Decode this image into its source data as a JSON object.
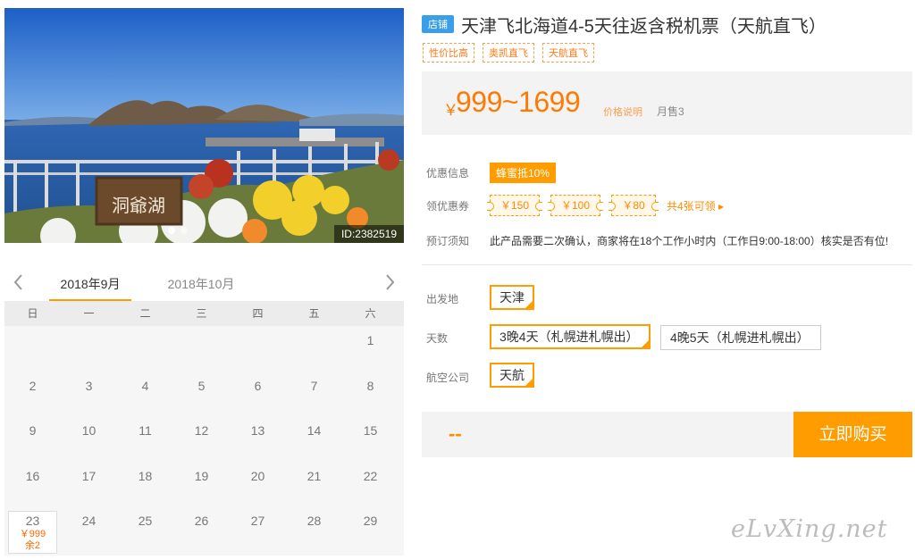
{
  "photo": {
    "id_label": "ID:2382519",
    "sign_text": "洞爺湖"
  },
  "calendar": {
    "tabs": [
      "2018年9月",
      "2018年10月"
    ],
    "weekdays": [
      "日",
      "一",
      "二",
      "三",
      "四",
      "五",
      "六"
    ],
    "days": [
      "",
      "",
      "",
      "",
      "",
      "",
      "1",
      "2",
      "3",
      "4",
      "5",
      "6",
      "7",
      "8",
      "9",
      "10",
      "11",
      "12",
      "13",
      "14",
      "15",
      "16",
      "17",
      "18",
      "19",
      "20",
      "21",
      "22",
      "23",
      "24",
      "25",
      "26",
      "27",
      "28",
      "29"
    ],
    "available_day": {
      "day": "23",
      "price": "￥999",
      "remaining": "余2"
    }
  },
  "product": {
    "shop_badge": "店铺",
    "title": "天津飞北海道4-5天往返含税机票（天航直飞）",
    "tags": [
      "性价比高",
      "奥凯直飞",
      "天航直飞"
    ],
    "price_symbol": "￥",
    "price_range": "999~1699",
    "price_explain": "价格说明",
    "monthly_sales": "月售3"
  },
  "info": {
    "promo_label": "优惠信息",
    "promo_badge": "蜂蜜抵10%",
    "coupon_label": "领优惠券",
    "coupons": [
      "￥150",
      "￥100",
      "￥80"
    ],
    "coupon_more": "共4张可领 ▸",
    "notice_label": "预订须知",
    "notice_text": "此产品需要二次确认，商家将在18个工作小时内（工作日9:00-18:00）核实是否有位!"
  },
  "options": {
    "departure_label": "出发地",
    "departure": "天津",
    "days_label": "天数",
    "days_options": [
      "3晚4天（札幌进札幌出）",
      "4晚5天（札幌进札幌出）"
    ],
    "airline_label": "航空公司",
    "airline": "天航"
  },
  "purchase": {
    "total_placeholder": "--",
    "buy_label": "立即购买"
  },
  "watermark": "eLvXing.net",
  "colors": {
    "accent": "#ff9d00",
    "price": "#ff7a00",
    "shop_badge": "#3a9ee8"
  }
}
